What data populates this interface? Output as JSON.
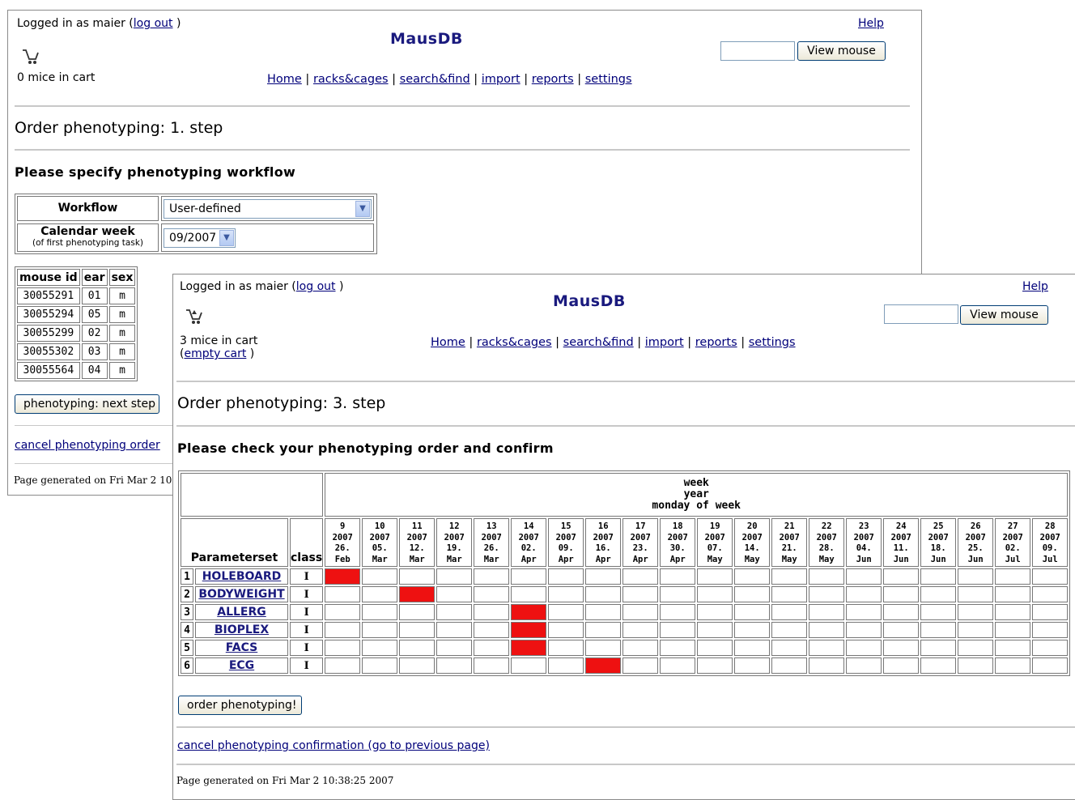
{
  "window1": {
    "login_prefix": "Logged in as maier (",
    "logout_label": "log out",
    "login_suffix": " )",
    "app_title": "MausDB",
    "help_label": "Help",
    "cart_icon": "cart-icon",
    "cart_text": "0 mice in cart",
    "view_mouse_label": "View mouse",
    "view_mouse_value": "",
    "nav": [
      "Home",
      "racks&cages",
      "search&find",
      "import",
      "reports",
      "settings"
    ],
    "nav_sep": " | ",
    "step_heading": "Order phenotyping: 1. step",
    "subheading": "Please specify phenotyping workflow",
    "workflow_label": "Workflow",
    "workflow_value": "User-defined",
    "calendar_label": "Calendar week",
    "calendar_sublabel": "(of first phenotyping task)",
    "calendar_value": "09/2007",
    "mouse_table": {
      "headers": [
        "mouse id",
        "ear",
        "sex"
      ],
      "rows": [
        [
          "30055291",
          "01",
          "m"
        ],
        [
          "30055294",
          "05",
          "m"
        ],
        [
          "30055299",
          "02",
          "m"
        ],
        [
          "30055302",
          "03",
          "m"
        ],
        [
          "30055564",
          "04",
          "m"
        ]
      ]
    },
    "next_step_label": "phenotyping: next step",
    "cancel_label": "cancel phenotyping order",
    "footer": "Page generated on Fri Mar 2 10"
  },
  "window2": {
    "login_prefix": "Logged in as maier (",
    "logout_label": "log out",
    "login_suffix": " )",
    "app_title": "MausDB",
    "help_label": "Help",
    "cart_icon": "cart-icon",
    "cart_text": "3 mice in cart",
    "empty_cart_prefix": "(",
    "empty_cart_label": "empty cart",
    "empty_cart_suffix": " )",
    "view_mouse_label": "View mouse",
    "view_mouse_value": "",
    "nav": [
      "Home",
      "racks&cages",
      "search&find",
      "import",
      "reports",
      "settings"
    ],
    "nav_sep": " | ",
    "step_heading": "Order phenotyping: 3. step",
    "subheading": "Please check your phenotyping order and confirm",
    "week_header": [
      "week",
      "year",
      "monday of week"
    ],
    "parameterset_label": "Parameterset",
    "class_label": "class",
    "weeks": [
      {
        "week": "9",
        "year": "2007",
        "day": "26.",
        "month": "Feb"
      },
      {
        "week": "10",
        "year": "2007",
        "day": "05.",
        "month": "Mar"
      },
      {
        "week": "11",
        "year": "2007",
        "day": "12.",
        "month": "Mar"
      },
      {
        "week": "12",
        "year": "2007",
        "day": "19.",
        "month": "Mar"
      },
      {
        "week": "13",
        "year": "2007",
        "day": "26.",
        "month": "Mar"
      },
      {
        "week": "14",
        "year": "2007",
        "day": "02.",
        "month": "Apr"
      },
      {
        "week": "15",
        "year": "2007",
        "day": "09.",
        "month": "Apr"
      },
      {
        "week": "16",
        "year": "2007",
        "day": "16.",
        "month": "Apr"
      },
      {
        "week": "17",
        "year": "2007",
        "day": "23.",
        "month": "Apr"
      },
      {
        "week": "18",
        "year": "2007",
        "day": "30.",
        "month": "Apr"
      },
      {
        "week": "19",
        "year": "2007",
        "day": "07.",
        "month": "May"
      },
      {
        "week": "20",
        "year": "2007",
        "day": "14.",
        "month": "May"
      },
      {
        "week": "21",
        "year": "2007",
        "day": "21.",
        "month": "May"
      },
      {
        "week": "22",
        "year": "2007",
        "day": "28.",
        "month": "May"
      },
      {
        "week": "23",
        "year": "2007",
        "day": "04.",
        "month": "Jun"
      },
      {
        "week": "24",
        "year": "2007",
        "day": "11.",
        "month": "Jun"
      },
      {
        "week": "25",
        "year": "2007",
        "day": "18.",
        "month": "Jun"
      },
      {
        "week": "26",
        "year": "2007",
        "day": "25.",
        "month": "Jun"
      },
      {
        "week": "27",
        "year": "2007",
        "day": "02.",
        "month": "Jul"
      },
      {
        "week": "28",
        "year": "2007",
        "day": "09.",
        "month": "Jul"
      }
    ],
    "parametersets": [
      {
        "num": "1",
        "name": "HOLEBOARD",
        "class": "I",
        "scheduled_week": "9"
      },
      {
        "num": "2",
        "name": "BODYWEIGHT",
        "class": "I",
        "scheduled_week": "11"
      },
      {
        "num": "3",
        "name": "ALLERG",
        "class": "I",
        "scheduled_week": "14"
      },
      {
        "num": "4",
        "name": "BIOPLEX",
        "class": "I",
        "scheduled_week": "14"
      },
      {
        "num": "5",
        "name": "FACS",
        "class": "I",
        "scheduled_week": "14"
      },
      {
        "num": "6",
        "name": "ECG",
        "class": "I",
        "scheduled_week": "16"
      }
    ],
    "scheduled_color": "#ee1111",
    "order_label": "order phenotyping!",
    "cancel_label": "cancel phenotyping confirmation (go to previous page)",
    "footer": "Page generated on Fri Mar 2 10:38:25 2007"
  }
}
